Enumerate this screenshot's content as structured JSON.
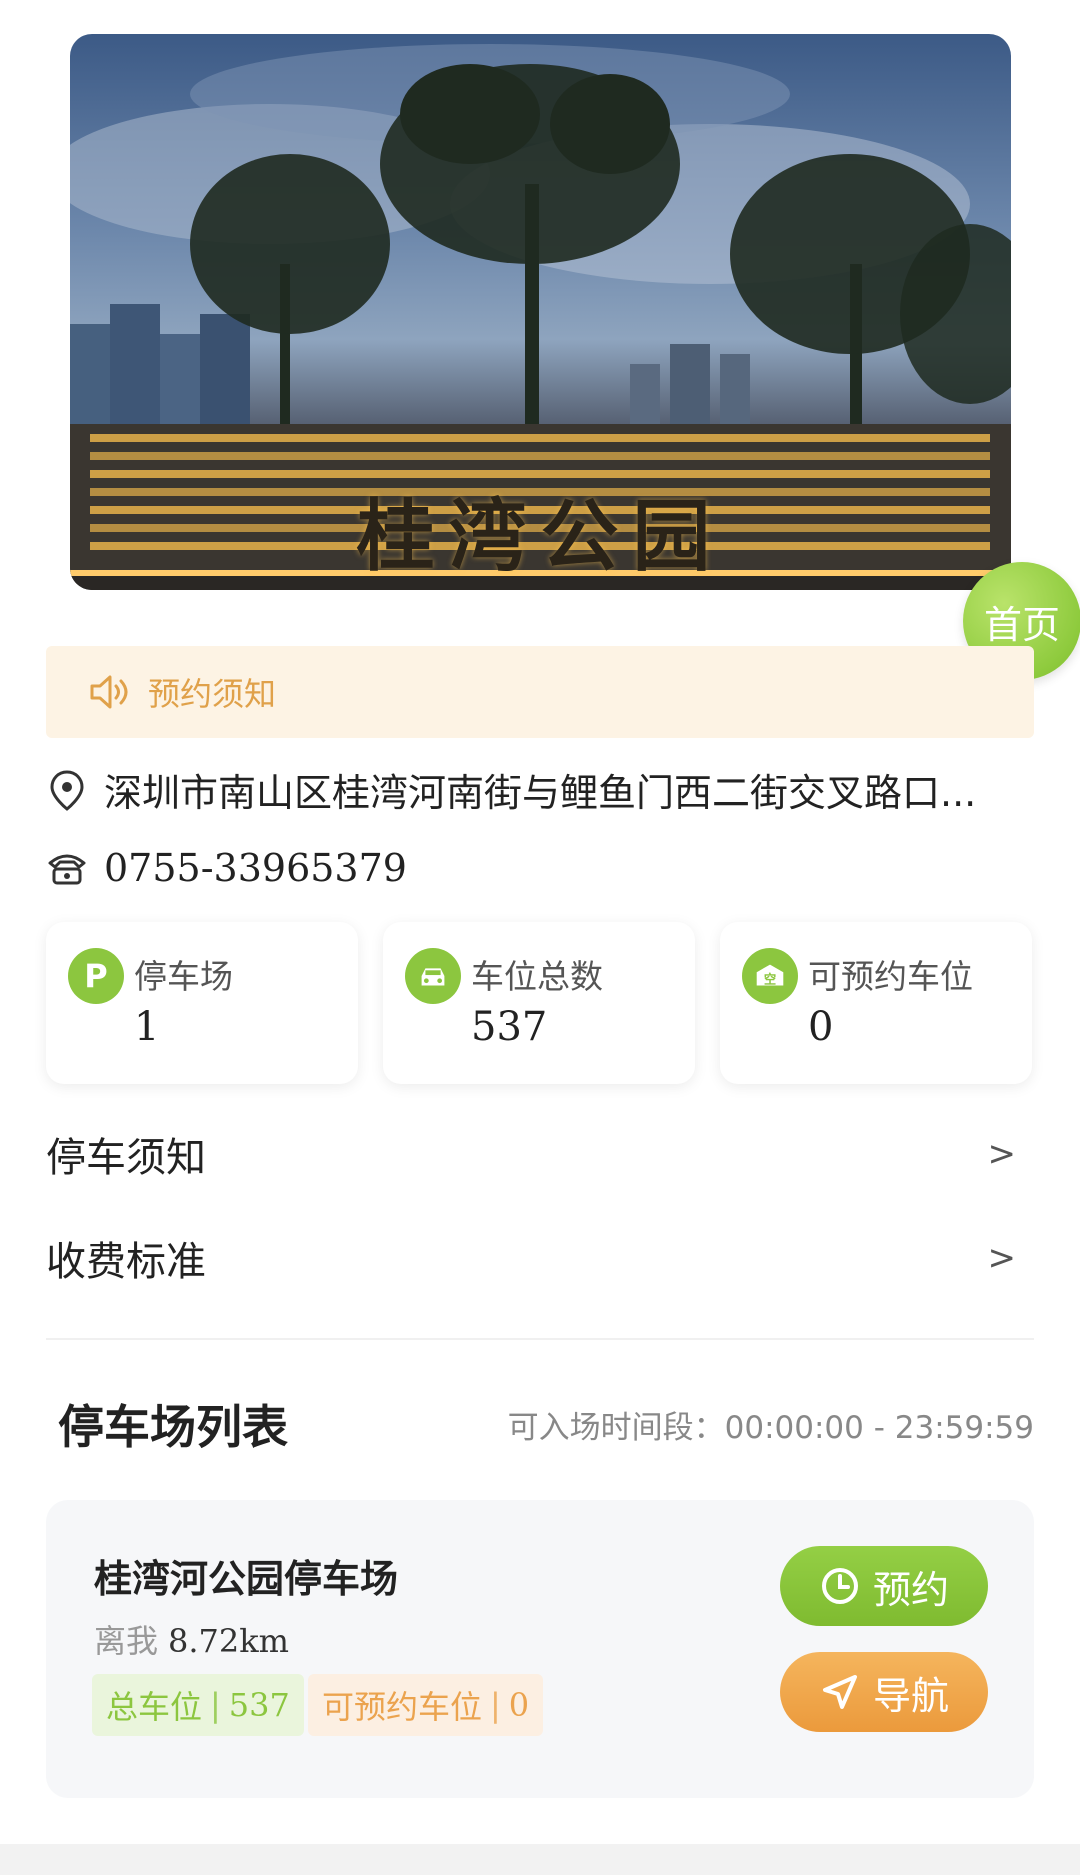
{
  "hero": {
    "sign_text": "桂湾公园"
  },
  "home_button": {
    "label": "首页"
  },
  "notice": {
    "label": "预约须知",
    "icon": "speaker-icon"
  },
  "address": {
    "text": "深圳市南山区桂湾河南街与鲤鱼门西二街交叉路口...",
    "icon": "location-pin-icon"
  },
  "phone": {
    "text": "0755-33965379",
    "icon": "phone-icon"
  },
  "stats": [
    {
      "label": "停车场",
      "value": "1",
      "icon": "parking-icon",
      "icon_text": "P"
    },
    {
      "label": "车位总数",
      "value": "537",
      "icon": "car-icon"
    },
    {
      "label": "可预约车位",
      "value": "0",
      "icon": "empty-space-icon",
      "icon_text": "空"
    }
  ],
  "links": [
    {
      "label": "停车须知",
      "arrow": ">"
    },
    {
      "label": "收费标准",
      "arrow": ">"
    }
  ],
  "list_section": {
    "title": "停车场列表",
    "time_range": "可入场时间段：00:00:00 - 23:59:59"
  },
  "lot": {
    "name": "桂湾河公园停车场",
    "distance_label": "离我",
    "distance_value": "8.72km",
    "total_tag_label": "总车位",
    "total_tag_value": "537",
    "reservable_tag_label": "可预约车位",
    "reservable_tag_value": "0",
    "tag_separator": "|",
    "reserve_button": "预约",
    "navigate_button": "导航"
  },
  "colors": {
    "accent_green": "#8cc63f",
    "accent_orange": "#eb9a3c",
    "notice_bg": "#fdf3e4",
    "notice_text": "#e0a14a"
  }
}
